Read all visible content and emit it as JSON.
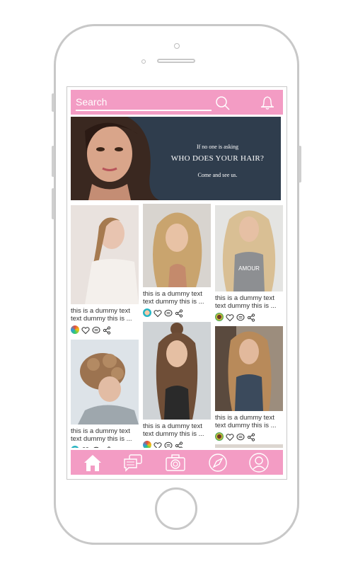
{
  "search": {
    "placeholder": "Search"
  },
  "banner": {
    "line1": "If no one is asking",
    "line2": "WHO DOES YOUR HAIR?",
    "line3": "Come and see us."
  },
  "posts": [
    {
      "caption1": "this is a dummy text",
      "caption2": "text dummy this is ..."
    },
    {
      "caption1": "this is a dummy text",
      "caption2": "text dummy this is ..."
    },
    {
      "caption1": "this is a dummy text",
      "caption2": "text dummy this is ..."
    },
    {
      "caption1": "this is a dummy text",
      "caption2": "text dummy this is ..."
    },
    {
      "caption1": "this is a dummy text",
      "caption2": "text dummy this is ..."
    },
    {
      "caption1": "this is a dummy text",
      "caption2": "text dummy this is ..."
    }
  ],
  "tabs": [
    "home-icon",
    "chat-icon",
    "camera-icon",
    "compass-icon",
    "profile-icon"
  ],
  "colors": {
    "accent": "#f39cc4",
    "banner_bg": "#2f3d4d",
    "frame": "#c8c8c8"
  }
}
